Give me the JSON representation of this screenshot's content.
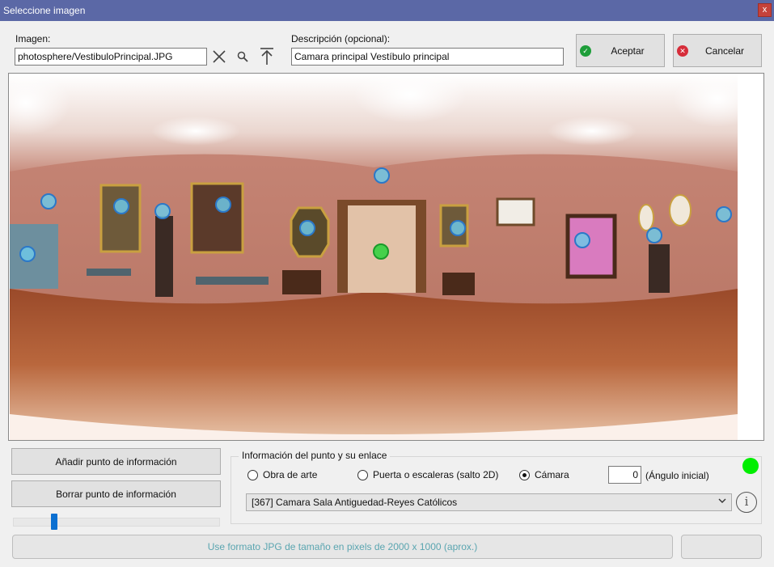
{
  "window": {
    "title": "Seleccione imagen",
    "close_glyph": "x"
  },
  "image": {
    "label": "Imagen:",
    "value": "photosphere/VestibuloPrincipal.JPG",
    "icons": [
      "clear-icon",
      "search-icon",
      "upload-icon"
    ]
  },
  "description": {
    "label": "Descripción (opcional):",
    "value": "Camara principal Vestíbulo principal"
  },
  "buttons": {
    "accept": "Aceptar",
    "cancel": "Cancelar",
    "add_point": "Añadir punto de información",
    "delete_point": "Borrar punto de información"
  },
  "point_info": {
    "group_title": "Información del punto y su enlace",
    "options": [
      {
        "label": "Obra de arte",
        "selected": false
      },
      {
        "label": "Puerta o escaleras (salto 2D)",
        "selected": false
      },
      {
        "label": "Cámara",
        "selected": true
      }
    ],
    "angle_value": "0",
    "angle_label": "(Ángulo inicial)",
    "link_selected": "[367] Camara Sala Antiguedad-Reyes Católicos",
    "status_color": "#00ee00"
  },
  "slider": {
    "value": 0.2
  },
  "footer": {
    "hint": "Use formato JPG de tamaño en pixels de 2000 x 1000 (aprox.)",
    "right_button": ""
  },
  "colors": {
    "titlebar": "#5b68a6",
    "accept_icon": "#1e9e3a",
    "cancel_icon": "#d62d3a",
    "hotspot": "#6ec8e6",
    "hotspot_active": "#3cd246"
  }
}
